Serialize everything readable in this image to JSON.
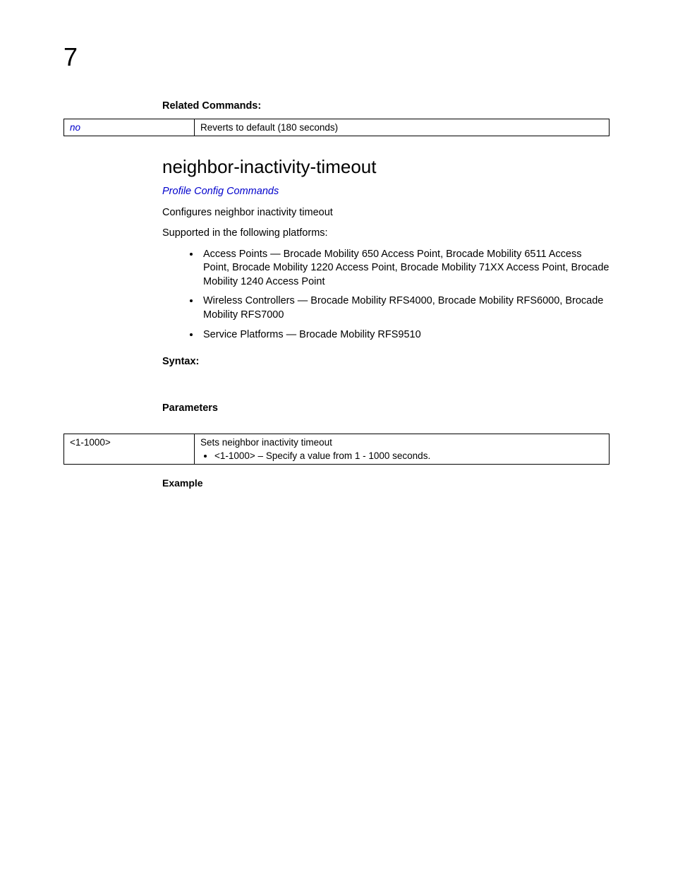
{
  "chapter": "7",
  "related_commands": {
    "heading": "Related Commands:",
    "rows": [
      {
        "name": "no",
        "description": "Reverts to default (180 seconds)"
      }
    ]
  },
  "command": {
    "name": "neighbor-inactivity-timeout",
    "section_link": "Profile Config Commands",
    "description": "Configures neighbor inactivity timeout",
    "supported_intro": "Supported in the following platforms:",
    "platforms": [
      "Access Points — Brocade Mobility 650 Access Point, Brocade Mobility 6511 Access Point, Brocade Mobility 1220 Access Point, Brocade Mobility 71XX Access Point, Brocade Mobility 1240 Access Point",
      "Wireless Controllers — Brocade Mobility RFS4000, Brocade Mobility RFS6000, Brocade Mobility RFS7000",
      "Service Platforms — Brocade Mobility RFS9510"
    ],
    "syntax_heading": "Syntax:",
    "parameters_heading": "Parameters",
    "params": [
      {
        "param": "<1-1000>",
        "desc_main": "Sets neighbor inactivity timeout",
        "desc_bullet": "<1-1000> – Specify a value from 1 - 1000 seconds."
      }
    ],
    "example_heading": "Example"
  }
}
